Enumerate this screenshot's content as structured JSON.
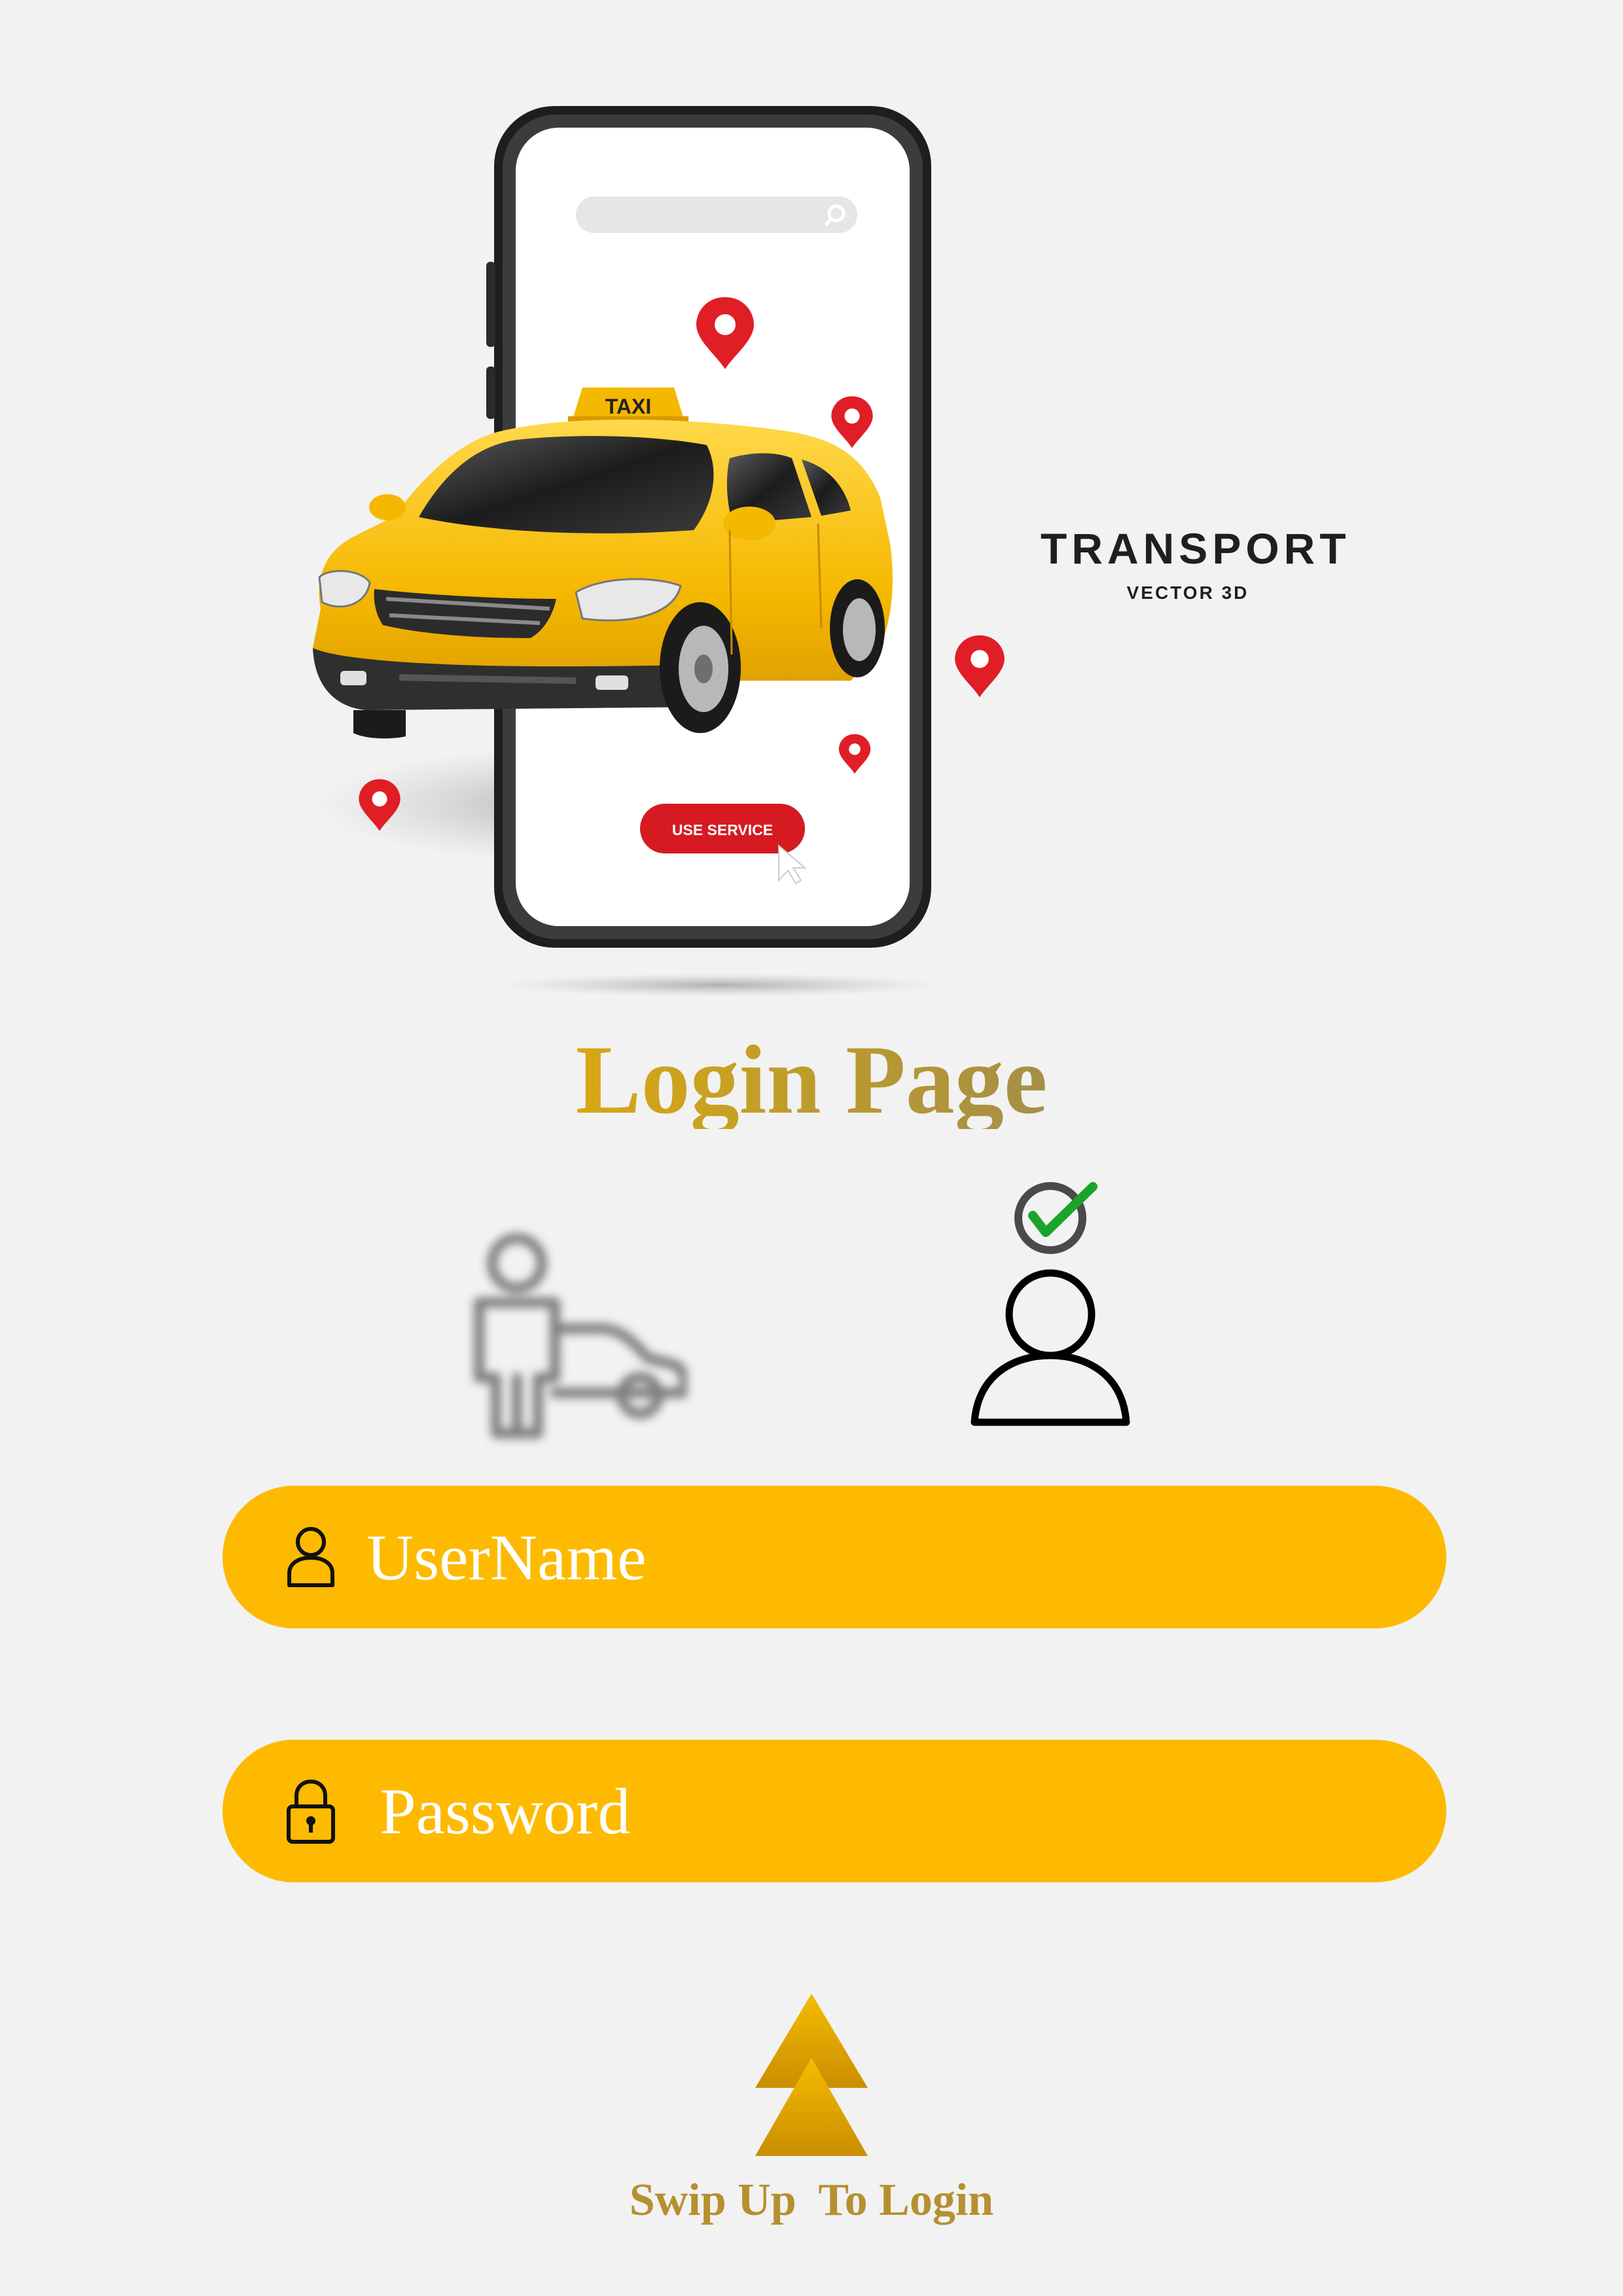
{
  "illustration": {
    "taxi_sign": "TAXI",
    "use_service_button": "USE SERVICE",
    "brand_title": "TRANSPORT",
    "brand_subtitle": "VECTOR 3D"
  },
  "title": "Login Page",
  "roles": {
    "options": [
      "driver",
      "user"
    ],
    "selected": "user"
  },
  "form": {
    "username_placeholder": "UserName",
    "password_placeholder": "Password"
  },
  "swipe": {
    "label": "Swip Up  To Login"
  },
  "colors": {
    "accent": "#fdba00",
    "background": "#f2f2f2",
    "swipe_label": "#b69030",
    "check": "#1aa52a"
  }
}
